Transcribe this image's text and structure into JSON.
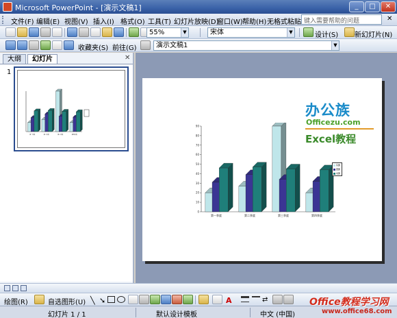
{
  "window": {
    "title": "Microsoft PowerPoint - [演示文稿1]"
  },
  "menu": {
    "items": [
      "文件(F)",
      "编辑(E)",
      "视图(V)",
      "插入(I)",
      "格式(O)",
      "工具(T)",
      "幻灯片放映(D)",
      "窗口(W)",
      "帮助(H)",
      "无格式粘贴"
    ],
    "help_placeholder": "键入需要帮助的问题"
  },
  "toolbar": {
    "zoom": "55%",
    "font": "宋体",
    "design_label": "设计(S)",
    "new_slide_label": "新幻灯片(N)"
  },
  "webbar": {
    "favorites_label": "收藏夹(S)",
    "go_label": "前往(G)",
    "address": "演示文稿1"
  },
  "pane": {
    "tabs": [
      "大纲",
      "幻灯片"
    ],
    "active_tab": "幻灯片",
    "slide_number": "1"
  },
  "slide": {
    "logo": {
      "brand": "办公族",
      "site": "Officezu.com",
      "subtitle": "Excel教程"
    },
    "legend": [
      "东部",
      "西部",
      "北部"
    ]
  },
  "chart_data": {
    "type": "bar",
    "categories": [
      "第一季度",
      "第二季度",
      "第三季度",
      "第四季度"
    ],
    "series": [
      {
        "name": "东部",
        "values": [
          20,
          27,
          90,
          20
        ],
        "color": "#bfe6ea"
      },
      {
        "name": "西部",
        "values": [
          31,
          39,
          34,
          32
        ],
        "color": "#3b3594"
      },
      {
        "name": "北部",
        "values": [
          46,
          47,
          45,
          44
        ],
        "color": "#1f7f7a"
      }
    ],
    "ylim": [
      0,
      90
    ],
    "yticks": [
      0,
      10,
      20,
      30,
      40,
      50,
      60,
      70,
      80,
      90
    ],
    "grid": false,
    "legend_position": "right"
  },
  "drawing": {
    "draw_label": "绘图(R)",
    "autoshapes_label": "自选图形(U)"
  },
  "status": {
    "slide_info": "幻灯片 1 / 1",
    "design": "默认设计模板",
    "language": "中文 (中国)"
  },
  "watermark": {
    "brand": "Office教程学习网",
    "url": "www.office68.com"
  }
}
